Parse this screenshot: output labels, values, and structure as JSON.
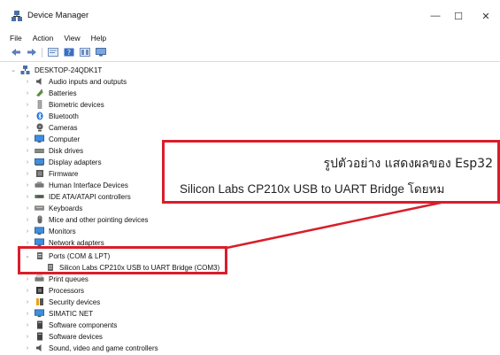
{
  "window": {
    "title": "Device Manager",
    "min_glyph": "—",
    "max_glyph": "☐",
    "close_glyph": "✕"
  },
  "menu": [
    "File",
    "Action",
    "View",
    "Help"
  ],
  "toolbar": [
    "back-icon",
    "forward-icon",
    "properties-icon",
    "help-icon",
    "update-driver-icon",
    "monitor-icon"
  ],
  "tree": {
    "root": "DESKTOP-24QDK1T",
    "items": [
      {
        "label": "Audio inputs and outputs",
        "icon": "speaker-icon"
      },
      {
        "label": "Batteries",
        "icon": "battery-icon"
      },
      {
        "label": "Biometric devices",
        "icon": "biometric-icon"
      },
      {
        "label": "Bluetooth",
        "icon": "bluetooth-icon"
      },
      {
        "label": "Cameras",
        "icon": "camera-icon"
      },
      {
        "label": "Computer",
        "icon": "computer-icon"
      },
      {
        "label": "Disk drives",
        "icon": "disk-icon"
      },
      {
        "label": "Display adapters",
        "icon": "display-adapter-icon"
      },
      {
        "label": "Firmware",
        "icon": "firmware-icon"
      },
      {
        "label": "Human Interface Devices",
        "icon": "hid-icon"
      },
      {
        "label": "IDE ATA/ATAPI controllers",
        "icon": "ide-icon"
      },
      {
        "label": "Keyboards",
        "icon": "keyboard-icon"
      },
      {
        "label": "Mice and other pointing devices",
        "icon": "mouse-icon"
      },
      {
        "label": "Monitors",
        "icon": "monitor-icon"
      },
      {
        "label": "Network adapters",
        "icon": "network-icon"
      },
      {
        "label": "Ports (COM & LPT)",
        "icon": "port-icon",
        "expanded": true
      },
      {
        "label": "Silicon Labs CP210x USB to UART Bridge (COM3)",
        "icon": "port-icon",
        "child": true
      },
      {
        "label": "Print queues",
        "icon": "printer-icon"
      },
      {
        "label": "Processors",
        "icon": "processor-icon"
      },
      {
        "label": "Security devices",
        "icon": "security-icon"
      },
      {
        "label": "SIMATIC NET",
        "icon": "simatic-icon"
      },
      {
        "label": "Software components",
        "icon": "software-component-icon"
      },
      {
        "label": "Software devices",
        "icon": "software-device-icon"
      },
      {
        "label": "Sound, video and game controllers",
        "icon": "sound-icon"
      }
    ]
  },
  "annotation": {
    "line1": "รูปตัวอย่าง แสดงผลของ Esp32",
    "line2": "Silicon Labs CP210x USB to UART Bridge โดยหม"
  },
  "colors": {
    "highlight_red": "#d81e2a",
    "folder_blue": "#3a7bd5"
  }
}
